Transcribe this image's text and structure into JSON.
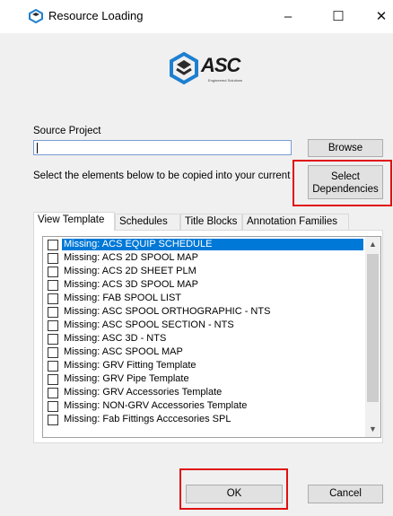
{
  "window": {
    "title": "Resource Loading",
    "minimize_glyph": "–",
    "maximize_glyph": "☐",
    "close_glyph": "✕"
  },
  "logo": {
    "brand": "ASC",
    "tagline": "Engineered Solutions",
    "colors": {
      "blue": "#1e7fd0",
      "dark": "#2b2b2b"
    }
  },
  "source_project": {
    "label": "Source Project",
    "value": "",
    "browse_label": "Browse"
  },
  "instructions": "Select the elements below to be copied  into your current",
  "select_dependencies": {
    "line1": "Select",
    "line2": "Dependencies"
  },
  "tabs": [
    {
      "label": "View Template",
      "active": true
    },
    {
      "label": "Schedules",
      "active": false
    },
    {
      "label": "Title Blocks",
      "active": false
    },
    {
      "label": "Annotation Families",
      "active": false
    }
  ],
  "items": [
    {
      "label": "Missing: ACS EQUIP SCHEDULE",
      "checked": false,
      "selected": true
    },
    {
      "label": "Missing: ACS 2D SPOOL MAP",
      "checked": false,
      "selected": false
    },
    {
      "label": "Missing: ACS 2D SHEET PLM",
      "checked": false,
      "selected": false
    },
    {
      "label": "Missing: ACS 3D SPOOL MAP",
      "checked": false,
      "selected": false
    },
    {
      "label": "Missing: FAB SPOOL LIST",
      "checked": false,
      "selected": false
    },
    {
      "label": "Missing: ASC SPOOL ORTHOGRAPHIC - NTS",
      "checked": false,
      "selected": false
    },
    {
      "label": "Missing: ASC SPOOL SECTION - NTS",
      "checked": false,
      "selected": false
    },
    {
      "label": "Missing: ASC 3D - NTS",
      "checked": false,
      "selected": false
    },
    {
      "label": "Missing: ASC SPOOL MAP",
      "checked": false,
      "selected": false
    },
    {
      "label": "Missing: GRV Fitting Template",
      "checked": false,
      "selected": false
    },
    {
      "label": "Missing: GRV Pipe Template",
      "checked": false,
      "selected": false
    },
    {
      "label": "Missing: GRV Accessories Template",
      "checked": false,
      "selected": false
    },
    {
      "label": "Missing: NON-GRV Accessories Template",
      "checked": false,
      "selected": false
    },
    {
      "label": "Missing: Fab Fittings Acccesories SPL",
      "checked": false,
      "selected": false
    }
  ],
  "footer": {
    "ok_label": "OK",
    "cancel_label": "Cancel"
  },
  "highlight_color": "#e01010"
}
